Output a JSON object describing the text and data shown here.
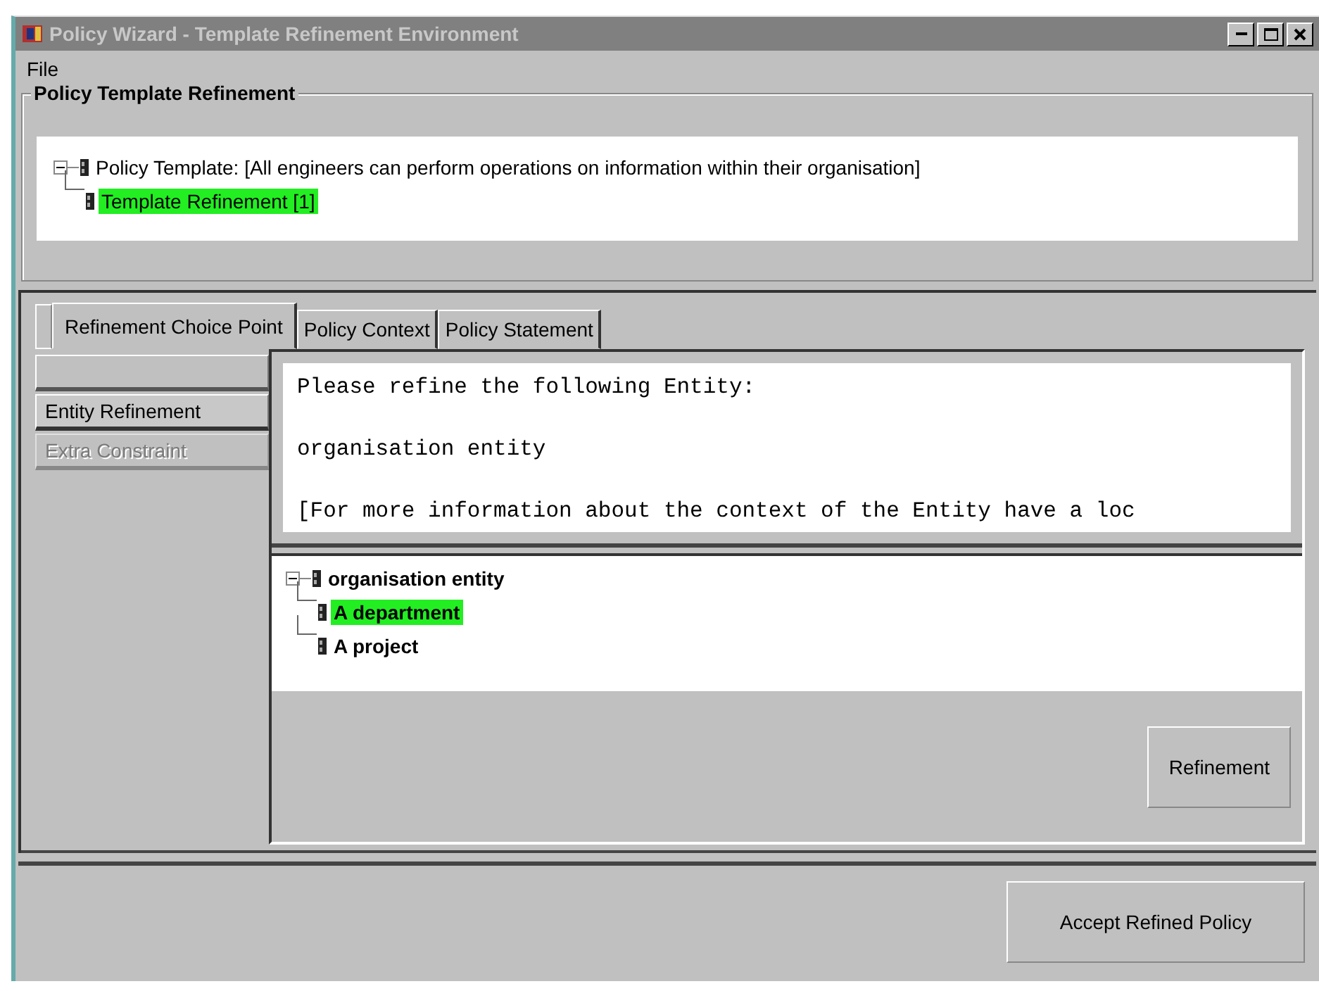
{
  "window": {
    "title": "Policy Wizard - Template Refinement Environment"
  },
  "menu": [
    {
      "label": "File"
    }
  ],
  "template_group": {
    "title": "Policy Template Refinement",
    "tree": [
      {
        "label": "Policy Template: [All engineers can perform operations on information within their organisation]",
        "expanded": true,
        "selected": false,
        "children": [
          {
            "label": "Template Refinement [1]",
            "selected": true
          }
        ]
      }
    ]
  },
  "tabs": [
    {
      "label": "Refinement Choice Point",
      "selected": true
    },
    {
      "label": "Policy Context",
      "selected": false
    },
    {
      "label": "Policy Statement",
      "selected": false
    }
  ],
  "choice_list": [
    {
      "selected": false,
      "disabled": false
    },
    {
      "label": "Entity Refinement",
      "selected": true,
      "disabled": false
    },
    {
      "label": "Extra Constraint",
      "selected": false,
      "disabled": true
    }
  ],
  "message": {
    "lines": [
      "Please refine the following Entity:",
      "organisation entity",
      "[For more information about the context of the Entity have a loc"
    ]
  },
  "entity_tree": [
    {
      "label": "organisation entity",
      "expanded": true,
      "selected": false,
      "children": [
        {
          "label": "A department",
          "selected": true
        },
        {
          "label": "A project",
          "selected": false
        }
      ]
    }
  ],
  "refine_button": "Refinement",
  "accept_button": "Accept Refined Policy"
}
